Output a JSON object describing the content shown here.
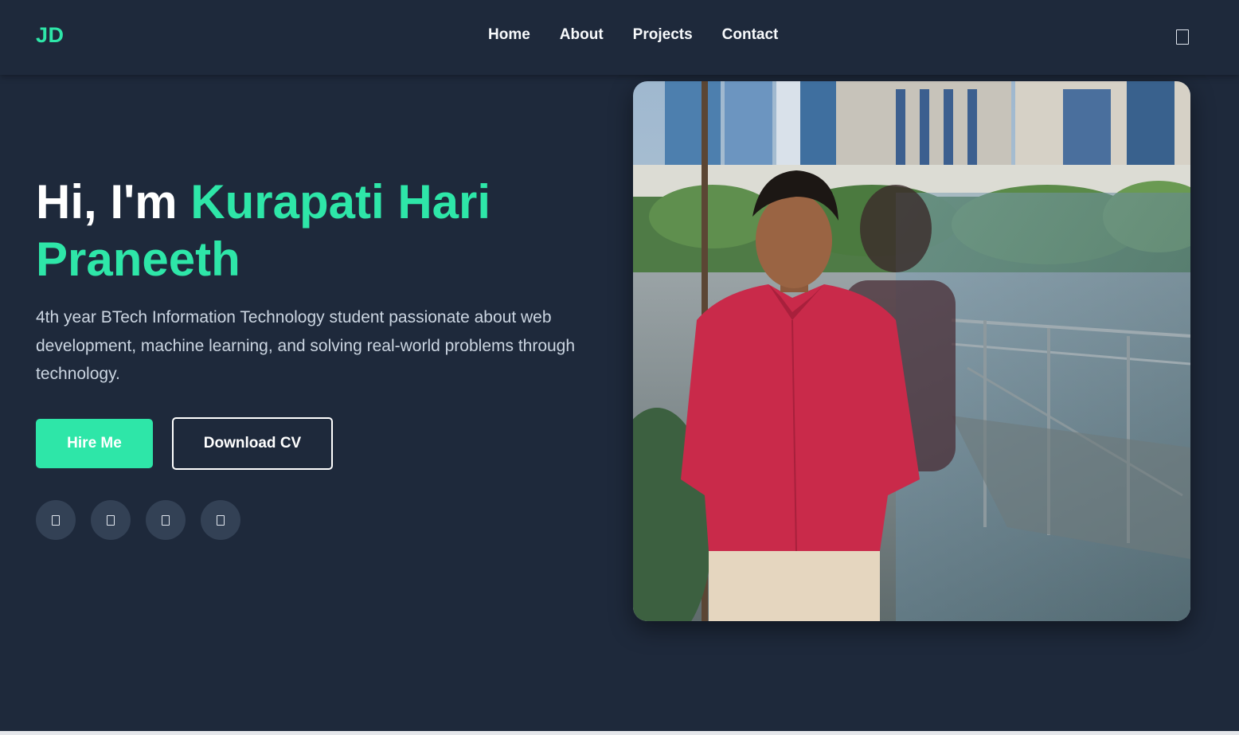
{
  "nav": {
    "logo": "JD",
    "links": [
      "Home",
      "About",
      "Projects",
      "Contact"
    ],
    "theme_icon": "theme-toggle-icon"
  },
  "hero": {
    "greeting": "Hi, I'm ",
    "name_line1": "Kurapati Hari",
    "name_line2": "Praneeth",
    "description": "4th year BTech Information Technology student passionate about web development, machine learning, and solving real-world problems through technology.",
    "hire_label": "Hire Me",
    "cv_label": "Download CV",
    "social_icons": [
      "github-icon",
      "linkedin-icon",
      "twitter-icon",
      "email-icon"
    ]
  },
  "colors": {
    "background": "#1e293b",
    "accent": "#2ee6a8",
    "social_bg": "#334155"
  }
}
